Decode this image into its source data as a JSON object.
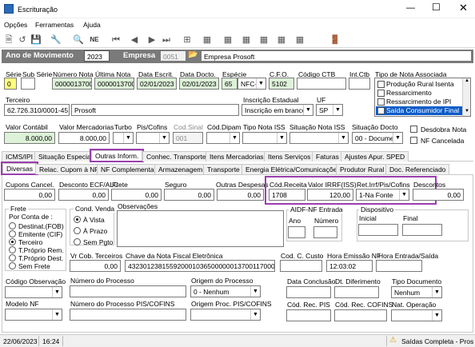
{
  "window": {
    "title": "Escrituração"
  },
  "menu": [
    "Opções",
    "Ferramentas",
    "Ajuda"
  ],
  "movimento": {
    "label": "Ano de Movimento",
    "value": "2023",
    "empresa_label": "Empresa",
    "empresa_code": "0051",
    "empresa_name": "Empresa Prosoft"
  },
  "row1": {
    "serie_label": "Série",
    "serie": "0",
    "subserie_label": "Sub Série",
    "subserie": "",
    "numero_label": "Número Nota",
    "numero": "0000013700",
    "ultima_label": "Última Nota",
    "ultima": "0000013700",
    "data_escrit_label": "Data Escrit.",
    "data_escrit": "02/01/2023",
    "data_docto_label": "Data Docto.",
    "data_docto": "02/01/2023",
    "especie_label": "Espécie",
    "especie": "65",
    "especie_sel": "NFC-",
    "cfo_label": "C.F.O.",
    "cfo": "5102",
    "codigo_ctb_label": "Código CTB",
    "codigo_ctb": "",
    "int_ctb_label": "Int.Ctb",
    "int_ctb": ""
  },
  "tipo_nota": {
    "label": "Tipo de Nota Associada",
    "items": [
      "Produção Rural Isenta",
      "Ressarcimento",
      "Ressarcimento de IPI",
      "Saída Consumidor Final"
    ]
  },
  "terceiro": {
    "label": "Terceiro",
    "cnpj": "62.726.310/0001-45",
    "nome": "Prosoft",
    "ie_label": "Inscrição Estadual",
    "ie": "Inscrição em branco",
    "uf_label": "UF",
    "uf": "SP"
  },
  "valores": {
    "contabil_label": "Valor Contábil",
    "contabil": "8.000,00",
    "mercadorias_label": "Valor Mercadorias",
    "mercadorias": "8.000,00",
    "turbo_label": "Turbo",
    "pis_label": "Pis/Cofins",
    "cod_sinal_label": "Cod.Sinal",
    "cod_sinal": "001",
    "cod_dipam_label": "Cód.Dipam",
    "tipo_iss_label": "Tipo Nota ISS",
    "sit_iss_label": "Situação Nota ISS",
    "sit_docto_label": "Situação Docto",
    "sit_docto": "00 - Documer",
    "desdobra_label": "Desdobra Nota",
    "cancelada_label": "NF Cancelada"
  },
  "tabs1": [
    "ICMS/IPI",
    "Situação Especial",
    "Outras Inform.",
    "Conhec. Transporte",
    "Itens Mercadorias",
    "Itens Serviços",
    "Faturas",
    "Ajustes Apur. SPED"
  ],
  "tabs2": [
    "Diversas",
    "Relac. Cupom à NF",
    "NF Complementar",
    "Armazenagem",
    "Transporte",
    "Energia Elétrica/Comunicações",
    "Produtor Rural",
    "Doc. Referenciado"
  ],
  "diversas": {
    "cupons_label": "Cupons Cancel.",
    "cupons": "0,00",
    "desconto_label": "Desconto ECF/ALC",
    "desconto": "0,00",
    "frete_label": "Frete",
    "frete": "0,00",
    "seguro_label": "Seguro",
    "seguro": "0,00",
    "outras_label": "Outras Despesas",
    "outras": "0,00",
    "cod_receita_label": "Cód.Receita",
    "cod_receita": "1708",
    "irrf_label": "Valor IRRF(ISS)",
    "irrf": "120,00",
    "ret_label": "Ret.Irrf/Pis/Cofins",
    "ret": "1-Na Fonte",
    "descontos_label": "Descontos",
    "descontos": "0,00",
    "frete_grp": "Frete",
    "conta_label": "Por Conta de :",
    "frete_opts": [
      "Destinat.(FOB)",
      "Emitente (CIF)",
      "Terceiro",
      "T.Próprio Rem.",
      "T.Próprio Dest.",
      "Sem Frete"
    ],
    "cond_label": "Cond. Venda",
    "cond_opts": [
      "À Vista",
      "À Prazo",
      "Sem Pgto"
    ],
    "obs_label": "Observações",
    "aidf_label": "AIDF-NF Entrada",
    "ano_label": "Ano",
    "numero_label": "Número",
    "disp_label": "Dispositivo",
    "inicial_label": "Inicial",
    "final_label": "Final",
    "vr_label": "Vr Cob. Terceiros",
    "vr": "0,00",
    "chave_label": "Chave da Nota Fiscal Eletrônica",
    "chave": "43230123815592000103650000001370011700000",
    "ccusto_label": "Cod. C. Custo",
    "hora_label": "Hora Emissão NF",
    "hora": "12:03:02",
    "hora_es_label": "Hora Entrada/Saída",
    "cod_obs_label": "Código Observação",
    "processo_label": "Número do Processo",
    "origem_label": "Origem do Processo",
    "origem": "0 - Nenhum",
    "data_conc_label": "Data Conclusão",
    "dt_dif_label": "Dt. Diferimento",
    "tipo_doc_label": "Tipo Documento",
    "tipo_doc": "Nenhum",
    "modelo_label": "Modelo NF",
    "proc_pis_label": "Número do Processo PIS/COFINS",
    "orig_pis_label": "Origem Proc. PIS/COFINS",
    "cod_rec_pis_label": "Cód. Rec. PIS",
    "cod_rec_cofins_label": "Cód. Rec. COFINS",
    "nat_label": "Nat. Operação"
  },
  "status": {
    "date": "22/06/2023",
    "time": "16:24",
    "mode": "Saídas Completa - Pros"
  }
}
